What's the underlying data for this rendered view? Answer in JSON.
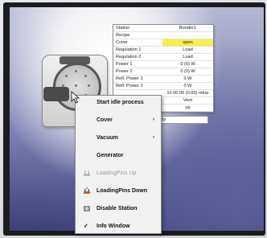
{
  "info_panel": {
    "rows": [
      {
        "key": "Station",
        "value": "Bonder1"
      },
      {
        "key": "Recipe",
        "value": ""
      },
      {
        "key": "Cover",
        "value": "open"
      },
      {
        "key": "Regulation 1",
        "value": "Load"
      },
      {
        "key": "Regulation 2",
        "value": "Load"
      },
      {
        "key": "Power 1",
        "value": "0 (0) W"
      },
      {
        "key": "Power 2",
        "value": "0 (0) W"
      },
      {
        "key": "Refl. Power 1",
        "value": "0 W"
      },
      {
        "key": "Refl. Power 2",
        "value": "0 W"
      },
      {
        "key": "",
        "value": "10 00.00 (0.00) mbar"
      },
      {
        "key": "",
        "value": "Vent"
      },
      {
        "key": "",
        "value": "up"
      }
    ],
    "status": "Ready"
  },
  "context_menu": {
    "items": [
      {
        "label": "Start idle process",
        "submenu": false,
        "enabled": true
      },
      {
        "label": "Cover",
        "submenu": true,
        "enabled": true
      },
      {
        "label": "Vacuum",
        "submenu": true,
        "enabled": true
      },
      {
        "label": "Generator",
        "submenu": false,
        "enabled": true
      },
      {
        "label": "LoadingPins Up",
        "submenu": false,
        "enabled": false
      },
      {
        "label": "LoadingPins Down",
        "submenu": false,
        "enabled": true
      },
      {
        "label": "Disable Station",
        "submenu": false,
        "enabled": true
      },
      {
        "label": "Info Window",
        "submenu": false,
        "enabled": true,
        "checked": true
      }
    ],
    "arrow_glyph": "›",
    "check_glyph": "✓"
  },
  "colors": {
    "highlight_cell": "#f4f04a",
    "menu_bg": "#f2f2f2",
    "disabled_text": "#9a9a9a"
  }
}
